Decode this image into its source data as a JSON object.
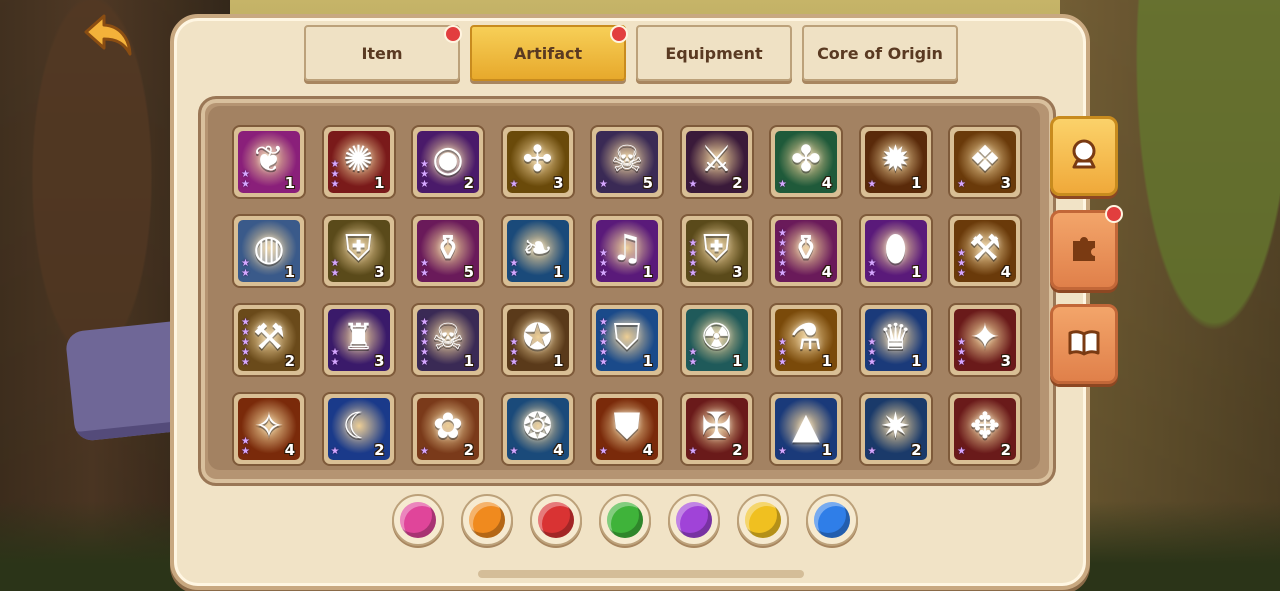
{
  "tabs": [
    {
      "label": "Item",
      "active": false,
      "badge": true
    },
    {
      "label": "Artifact",
      "active": true,
      "badge": true
    },
    {
      "label": "Equipment",
      "active": false,
      "badge": false
    },
    {
      "label": "Core of Origin",
      "active": false,
      "badge": false
    }
  ],
  "side_tabs": [
    {
      "icon": "crystal-ball-icon",
      "active": true,
      "badge": false
    },
    {
      "icon": "puzzle-icon",
      "active": false,
      "badge": true
    },
    {
      "icon": "book-icon",
      "active": false,
      "badge": false
    }
  ],
  "artifacts": [
    {
      "icon": "thorn-vine-icon",
      "glyph": "❦",
      "bg": "#8a1f7a",
      "stars": 2,
      "count": "1"
    },
    {
      "icon": "red-scroll-icon",
      "glyph": "✺",
      "bg": "#7a1a1a",
      "stars": 3,
      "count": "1"
    },
    {
      "icon": "purple-orb-icon",
      "glyph": "◉",
      "bg": "#4a1a6a",
      "stars": 3,
      "count": "2"
    },
    {
      "icon": "golden-crossbow-icon",
      "glyph": "✣",
      "bg": "#6a4a0a",
      "stars": 1,
      "count": "3"
    },
    {
      "icon": "skull-helm-icon",
      "glyph": "☠",
      "bg": "#3a2a55",
      "stars": 1,
      "count": "5"
    },
    {
      "icon": "dark-blade-icon",
      "glyph": "⚔",
      "bg": "#3a1a3a",
      "stars": 1,
      "count": "2"
    },
    {
      "icon": "green-tome-icon",
      "glyph": "✤",
      "bg": "#1f5a3a",
      "stars": 1,
      "count": "4"
    },
    {
      "icon": "dark-gem-icon",
      "glyph": "✹",
      "bg": "#5a2a0a",
      "stars": 1,
      "count": "1"
    },
    {
      "icon": "ice-crystal-icon",
      "glyph": "❖",
      "bg": "#6a3a0a",
      "stars": 1,
      "count": "3"
    },
    {
      "icon": "crystal-ball-stand-icon",
      "glyph": "◍",
      "bg": "#3a5a8a",
      "stars": 2,
      "count": "1"
    },
    {
      "icon": "golden-armor-icon",
      "glyph": "⛨",
      "bg": "#5a4a1a",
      "stars": 2,
      "count": "3"
    },
    {
      "icon": "pink-potion-icon",
      "glyph": "⚱",
      "bg": "#6a1a5a",
      "stars": 2,
      "count": "5"
    },
    {
      "icon": "emerald-leaf-icon",
      "glyph": "❧",
      "bg": "#1a4a7a",
      "stars": 2,
      "count": "1"
    },
    {
      "icon": "music-cube-icon",
      "glyph": "♫",
      "bg": "#5a1a7a",
      "stars": 3,
      "count": "1"
    },
    {
      "icon": "golden-armor-icon",
      "glyph": "⛨",
      "bg": "#5a4a1a",
      "stars": 4,
      "count": "3"
    },
    {
      "icon": "magic-potion-icon",
      "glyph": "⚱",
      "bg": "#6a1a5a",
      "stars": 5,
      "count": "4"
    },
    {
      "icon": "purple-egg-icon",
      "glyph": "⬮",
      "bg": "#5a1a7a",
      "stars": 2,
      "count": "1"
    },
    {
      "icon": "skull-axe-icon",
      "glyph": "⚒",
      "bg": "#6a3a0a",
      "stars": 3,
      "count": "4"
    },
    {
      "icon": "skull-axe-icon",
      "glyph": "⚒",
      "bg": "#6a4a1a",
      "stars": 5,
      "count": "2"
    },
    {
      "icon": "dark-cloak-icon",
      "glyph": "♜",
      "bg": "#3a1a6a",
      "stars": 2,
      "count": "3"
    },
    {
      "icon": "skull-lantern-icon",
      "glyph": "☠",
      "bg": "#3a2a55",
      "stars": 5,
      "count": "1"
    },
    {
      "icon": "bat-bomb-icon",
      "glyph": "✪",
      "bg": "#5a3a1a",
      "stars": 3,
      "count": "1"
    },
    {
      "icon": "blue-shield-icon",
      "glyph": "⛉",
      "bg": "#1a4a8a",
      "stars": 5,
      "count": "1"
    },
    {
      "icon": "stone-tablet-icon",
      "glyph": "☢",
      "bg": "#1f5a5a",
      "stars": 2,
      "count": "1"
    },
    {
      "icon": "blue-flask-icon",
      "glyph": "⚗",
      "bg": "#7a4a0a",
      "stars": 3,
      "count": "1"
    },
    {
      "icon": "winged-helm-icon",
      "glyph": "♛",
      "bg": "#1a3a7a",
      "stars": 3,
      "count": "1"
    },
    {
      "icon": "fire-gem-icon",
      "glyph": "✦",
      "bg": "#6a1a1a",
      "stars": 3,
      "count": "3"
    },
    {
      "icon": "green-sword-icon",
      "glyph": "✧",
      "bg": "#7a2a0a",
      "stars": 2,
      "count": "4"
    },
    {
      "icon": "moon-crown-icon",
      "glyph": "☾",
      "bg": "#1a3a8a",
      "stars": 1,
      "count": "2"
    },
    {
      "icon": "ancient-tome-icon",
      "glyph": "✿",
      "bg": "#7a3a1a",
      "stars": 1,
      "count": "2"
    },
    {
      "icon": "emerald-ring-icon",
      "glyph": "❂",
      "bg": "#1a4a7a",
      "stars": 1,
      "count": "4"
    },
    {
      "icon": "silver-shield-icon",
      "glyph": "⛊",
      "bg": "#7a2a0a",
      "stars": 1,
      "count": "4"
    },
    {
      "icon": "fire-axe-icon",
      "glyph": "✠",
      "bg": "#6a1a1a",
      "stars": 1,
      "count": "2"
    },
    {
      "icon": "witch-hat-icon",
      "glyph": "▲",
      "bg": "#1a3a7a",
      "stars": 1,
      "count": "1"
    },
    {
      "icon": "ice-shard-icon",
      "glyph": "✷",
      "bg": "#1a3a6a",
      "stars": 1,
      "count": "2"
    },
    {
      "icon": "dragon-claw-icon",
      "glyph": "✥",
      "bg": "#6a1a1a",
      "stars": 1,
      "count": "2"
    }
  ],
  "color_filters": [
    {
      "name": "pink-filter",
      "color": "#e0459a"
    },
    {
      "name": "orange-filter",
      "color": "#f08a1e"
    },
    {
      "name": "red-filter",
      "color": "#d93333"
    },
    {
      "name": "green-filter",
      "color": "#3fb33a"
    },
    {
      "name": "purple-filter",
      "color": "#a043d8"
    },
    {
      "name": "yellow-filter",
      "color": "#f0c020"
    },
    {
      "name": "blue-filter",
      "color": "#2f7ee8"
    }
  ]
}
